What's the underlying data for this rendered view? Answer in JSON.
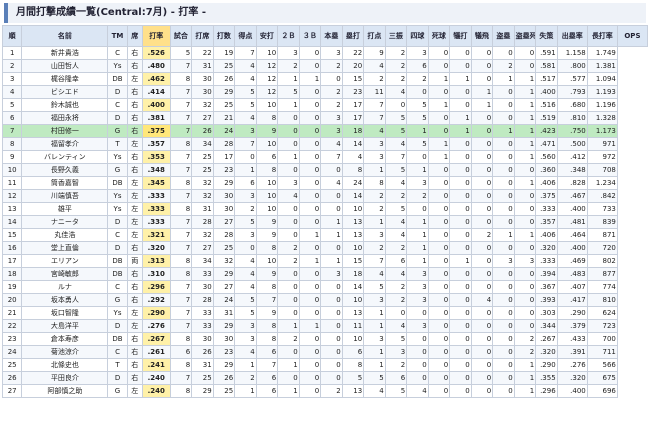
{
  "page": {
    "title": "月間打撃成績一覧(Central:7月) - 打率 -"
  },
  "headers": [
    "順",
    "名前",
    "TM",
    "席",
    "打率",
    "試合",
    "打席",
    "打数",
    "得点",
    "安打",
    "２Ｂ",
    "３Ｂ",
    "本塁",
    "塁打",
    "打点",
    "三振",
    "四球",
    "死球",
    "犠打",
    "犠飛",
    "盗塁",
    "盗塁死",
    "失策",
    "出塁率",
    "長打率",
    "OPS"
  ],
  "highlight_index": 6,
  "rows": [
    [
      "1",
      "新井貴浩",
      "C",
      "右",
      ".526",
      "5",
      "22",
      "19",
      "7",
      "10",
      "3",
      "0",
      "3",
      "22",
      "9",
      "2",
      "3",
      "0",
      "0",
      "0",
      "0",
      "0",
      ".591",
      "1.158",
      "1.749"
    ],
    [
      "2",
      "山田哲人",
      "Ys",
      "右",
      ".480",
      "7",
      "31",
      "25",
      "4",
      "12",
      "2",
      "0",
      "2",
      "20",
      "4",
      "2",
      "6",
      "0",
      "0",
      "0",
      "2",
      "0",
      ".581",
      ".800",
      "1.381"
    ],
    [
      "3",
      "梶谷隆幸",
      "DB",
      "左",
      ".462",
      "8",
      "30",
      "26",
      "4",
      "12",
      "1",
      "1",
      "0",
      "15",
      "2",
      "2",
      "2",
      "1",
      "1",
      "0",
      "1",
      "1",
      ".517",
      ".577",
      "1.094"
    ],
    [
      "4",
      "ビシエド",
      "D",
      "右",
      ".414",
      "7",
      "30",
      "29",
      "5",
      "12",
      "5",
      "0",
      "2",
      "23",
      "11",
      "4",
      "0",
      "0",
      "0",
      "1",
      "0",
      "1",
      ".400",
      ".793",
      "1.193"
    ],
    [
      "5",
      "鈴木誠也",
      "C",
      "右",
      ".400",
      "7",
      "32",
      "25",
      "5",
      "10",
      "1",
      "0",
      "2",
      "17",
      "7",
      "0",
      "5",
      "1",
      "0",
      "1",
      "0",
      "1",
      ".516",
      ".680",
      "1.196"
    ],
    [
      "6",
      "福田永将",
      "D",
      "右",
      ".381",
      "7",
      "27",
      "21",
      "4",
      "8",
      "0",
      "0",
      "3",
      "17",
      "7",
      "5",
      "5",
      "0",
      "1",
      "0",
      "0",
      "1",
      ".519",
      ".810",
      "1.328"
    ],
    [
      "7",
      "村田修一",
      "G",
      "右",
      ".375",
      "7",
      "26",
      "24",
      "3",
      "9",
      "0",
      "0",
      "3",
      "18",
      "4",
      "5",
      "1",
      "0",
      "1",
      "0",
      "1",
      "1",
      ".423",
      ".750",
      "1.173"
    ],
    [
      "8",
      "福留孝介",
      "T",
      "左",
      ".357",
      "8",
      "34",
      "28",
      "7",
      "10",
      "0",
      "0",
      "4",
      "14",
      "3",
      "4",
      "5",
      "1",
      "0",
      "0",
      "0",
      "1",
      ".471",
      ".500",
      "971"
    ],
    [
      "9",
      "バレンティン",
      "Ys",
      "右",
      ".353",
      "7",
      "25",
      "17",
      "0",
      "6",
      "1",
      "0",
      "7",
      "4",
      "3",
      "7",
      "0",
      "1",
      "0",
      "0",
      "0",
      "1",
      ".560",
      ".412",
      "972"
    ],
    [
      "10",
      "長野久義",
      "G",
      "右",
      ".348",
      "7",
      "25",
      "23",
      "1",
      "8",
      "0",
      "0",
      "0",
      "8",
      "1",
      "5",
      "1",
      "0",
      "0",
      "0",
      "0",
      "0",
      ".360",
      ".348",
      "708"
    ],
    [
      "11",
      "筒香嘉智",
      "DB",
      "左",
      ".345",
      "8",
      "32",
      "29",
      "6",
      "10",
      "3",
      "0",
      "4",
      "24",
      "8",
      "4",
      "3",
      "0",
      "0",
      "0",
      "0",
      "1",
      ".406",
      ".828",
      "1.234"
    ],
    [
      "12",
      "川端慎吾",
      "Ys",
      "左",
      ".333",
      "7",
      "32",
      "30",
      "3",
      "10",
      "4",
      "0",
      "0",
      "14",
      "2",
      "2",
      "2",
      "0",
      "0",
      "0",
      "0",
      "0",
      ".375",
      ".467",
      ".842"
    ],
    [
      "13",
      "雄平",
      "Ys",
      "左",
      ".333",
      "8",
      "31",
      "30",
      "2",
      "10",
      "0",
      "0",
      "0",
      "10",
      "2",
      "5",
      "0",
      "0",
      "0",
      "0",
      "0",
      "0",
      ".333",
      ".400",
      "733"
    ],
    [
      "14",
      "ナニータ",
      "D",
      "左",
      ".333",
      "7",
      "28",
      "27",
      "5",
      "9",
      "0",
      "0",
      "1",
      "13",
      "1",
      "4",
      "1",
      "0",
      "0",
      "0",
      "0",
      "0",
      ".357",
      ".481",
      "839"
    ],
    [
      "15",
      "丸佳浩",
      "C",
      "左",
      ".321",
      "7",
      "32",
      "28",
      "3",
      "9",
      "0",
      "1",
      "1",
      "13",
      "3",
      "4",
      "1",
      "0",
      "0",
      "2",
      "1",
      "1",
      ".406",
      ".464",
      "871"
    ],
    [
      "16",
      "堂上直倫",
      "D",
      "右",
      ".320",
      "7",
      "27",
      "25",
      "0",
      "8",
      "2",
      "0",
      "0",
      "10",
      "2",
      "2",
      "1",
      "0",
      "0",
      "0",
      "0",
      "0",
      ".320",
      ".400",
      "720"
    ],
    [
      "17",
      "エリアン",
      "DB",
      "両",
      ".313",
      "8",
      "34",
      "32",
      "4",
      "10",
      "2",
      "1",
      "1",
      "15",
      "7",
      "6",
      "1",
      "0",
      "1",
      "0",
      "3",
      "3",
      ".333",
      ".469",
      "802"
    ],
    [
      "18",
      "宮崎敏郎",
      "DB",
      "右",
      ".310",
      "8",
      "33",
      "29",
      "4",
      "9",
      "0",
      "0",
      "3",
      "18",
      "4",
      "4",
      "3",
      "0",
      "0",
      "0",
      "0",
      "0",
      ".394",
      ".483",
      "877"
    ],
    [
      "19",
      "ルナ",
      "C",
      "右",
      ".296",
      "7",
      "30",
      "27",
      "4",
      "8",
      "0",
      "0",
      "0",
      "14",
      "5",
      "2",
      "3",
      "0",
      "0",
      "0",
      "0",
      "0",
      ".367",
      ".407",
      "774"
    ],
    [
      "20",
      "坂本勇人",
      "G",
      "右",
      ".292",
      "7",
      "28",
      "24",
      "5",
      "7",
      "0",
      "0",
      "0",
      "10",
      "3",
      "2",
      "3",
      "0",
      "0",
      "4",
      "0",
      "0",
      ".393",
      ".417",
      "810"
    ],
    [
      "21",
      "坂口智隆",
      "Ys",
      "左",
      ".290",
      "7",
      "33",
      "31",
      "5",
      "9",
      "0",
      "0",
      "0",
      "13",
      "1",
      "0",
      "0",
      "0",
      "0",
      "0",
      "0",
      "0",
      ".303",
      ".290",
      "624"
    ],
    [
      "22",
      "大島洋平",
      "D",
      "左",
      ".276",
      "7",
      "33",
      "29",
      "3",
      "8",
      "1",
      "1",
      "0",
      "11",
      "1",
      "4",
      "3",
      "0",
      "0",
      "0",
      "0",
      "0",
      ".344",
      ".379",
      "723"
    ],
    [
      "23",
      "倉本寿彦",
      "DB",
      "右",
      ".267",
      "8",
      "30",
      "30",
      "3",
      "8",
      "2",
      "0",
      "0",
      "10",
      "3",
      "5",
      "0",
      "0",
      "0",
      "0",
      "0",
      "2",
      ".267",
      ".433",
      "700"
    ],
    [
      "24",
      "菊池涼介",
      "C",
      "右",
      ".261",
      "6",
      "26",
      "23",
      "4",
      "6",
      "0",
      "0",
      "0",
      "6",
      "1",
      "3",
      "0",
      "0",
      "0",
      "0",
      "0",
      "2",
      ".320",
      ".391",
      "711"
    ],
    [
      "25",
      "北條史也",
      "T",
      "右",
      ".241",
      "8",
      "31",
      "29",
      "1",
      "7",
      "1",
      "0",
      "0",
      "8",
      "1",
      "2",
      "0",
      "0",
      "0",
      "0",
      "0",
      "1",
      ".290",
      ".276",
      "566"
    ],
    [
      "26",
      "平田良介",
      "D",
      "右",
      ".240",
      "7",
      "25",
      "26",
      "2",
      "6",
      "0",
      "0",
      "0",
      "5",
      "5",
      "6",
      "0",
      "0",
      "0",
      "0",
      "0",
      "1",
      ".355",
      ".320",
      "675"
    ],
    [
      "27",
      "阿部慎之助",
      "G",
      "左",
      ".240",
      "8",
      "29",
      "25",
      "1",
      "6",
      "1",
      "0",
      "2",
      "13",
      "4",
      "5",
      "4",
      "0",
      "0",
      "0",
      "0",
      "1",
      ".296",
      ".400",
      "696"
    ]
  ]
}
